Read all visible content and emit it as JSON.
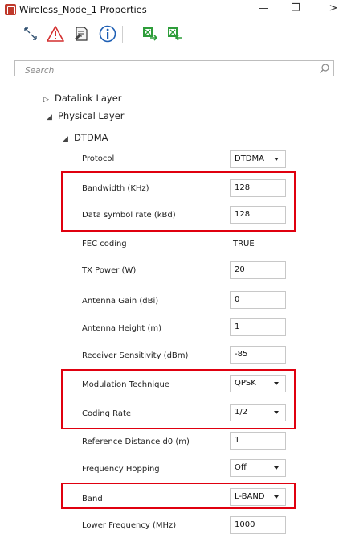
{
  "window": {
    "title": "Wireless_Node_1 Properties",
    "minimize_glyph": "—",
    "maximize_glyph": "❐",
    "close_glyph": ">"
  },
  "toolbar": {
    "buttons": [
      {
        "icon": "expand-collapse-icon"
      },
      {
        "icon": "warning-icon"
      },
      {
        "icon": "properties-sheet-icon"
      },
      {
        "icon": "info-icon"
      },
      {
        "icon": "export-excel-icon"
      },
      {
        "icon": "import-excel-icon"
      }
    ]
  },
  "search": {
    "placeholder": "Search",
    "icon": "search-icon"
  },
  "tree": {
    "datalink": "Datalink Layer",
    "physical": "Physical Layer",
    "dtdma": "DTDMA",
    "collapsed_arrow": "▷",
    "expanded_arrow": "◢"
  },
  "properties": {
    "protocol": {
      "label": "Protocol",
      "value": "DTDMA"
    },
    "bandwidth": {
      "label": "Bandwidth (KHz)",
      "value": "128"
    },
    "symbol_rate": {
      "label": "Data symbol rate (kBd)",
      "value": "128"
    },
    "fec": {
      "label": "FEC coding",
      "value": "TRUE"
    },
    "tx_power": {
      "label": "TX Power (W)",
      "value": "20"
    },
    "antenna_gain": {
      "label": "Antenna Gain (dBi)",
      "value": "0"
    },
    "antenna_height": {
      "label": "Antenna Height (m)",
      "value": "1"
    },
    "rx_sensitivity": {
      "label": "Receiver Sensitivity (dBm)",
      "value": "-85"
    },
    "modulation": {
      "label": "Modulation Technique",
      "value": "QPSK"
    },
    "coding_rate": {
      "label": "Coding Rate",
      "value": "1/2"
    },
    "ref_distance": {
      "label": "Reference Distance d0 (m)",
      "value": "1"
    },
    "freq_hopping": {
      "label": "Frequency Hopping",
      "value": "Off"
    },
    "band": {
      "label": "Band",
      "value": "L-BAND"
    },
    "lower_freq": {
      "label": "Lower Frequency (MHz)",
      "value": "1000"
    }
  },
  "colors": {
    "highlight": "#e0000f",
    "accent_green": "#2e9d3a",
    "warning_red": "#d32f2f",
    "info_blue": "#1e5fb4"
  }
}
